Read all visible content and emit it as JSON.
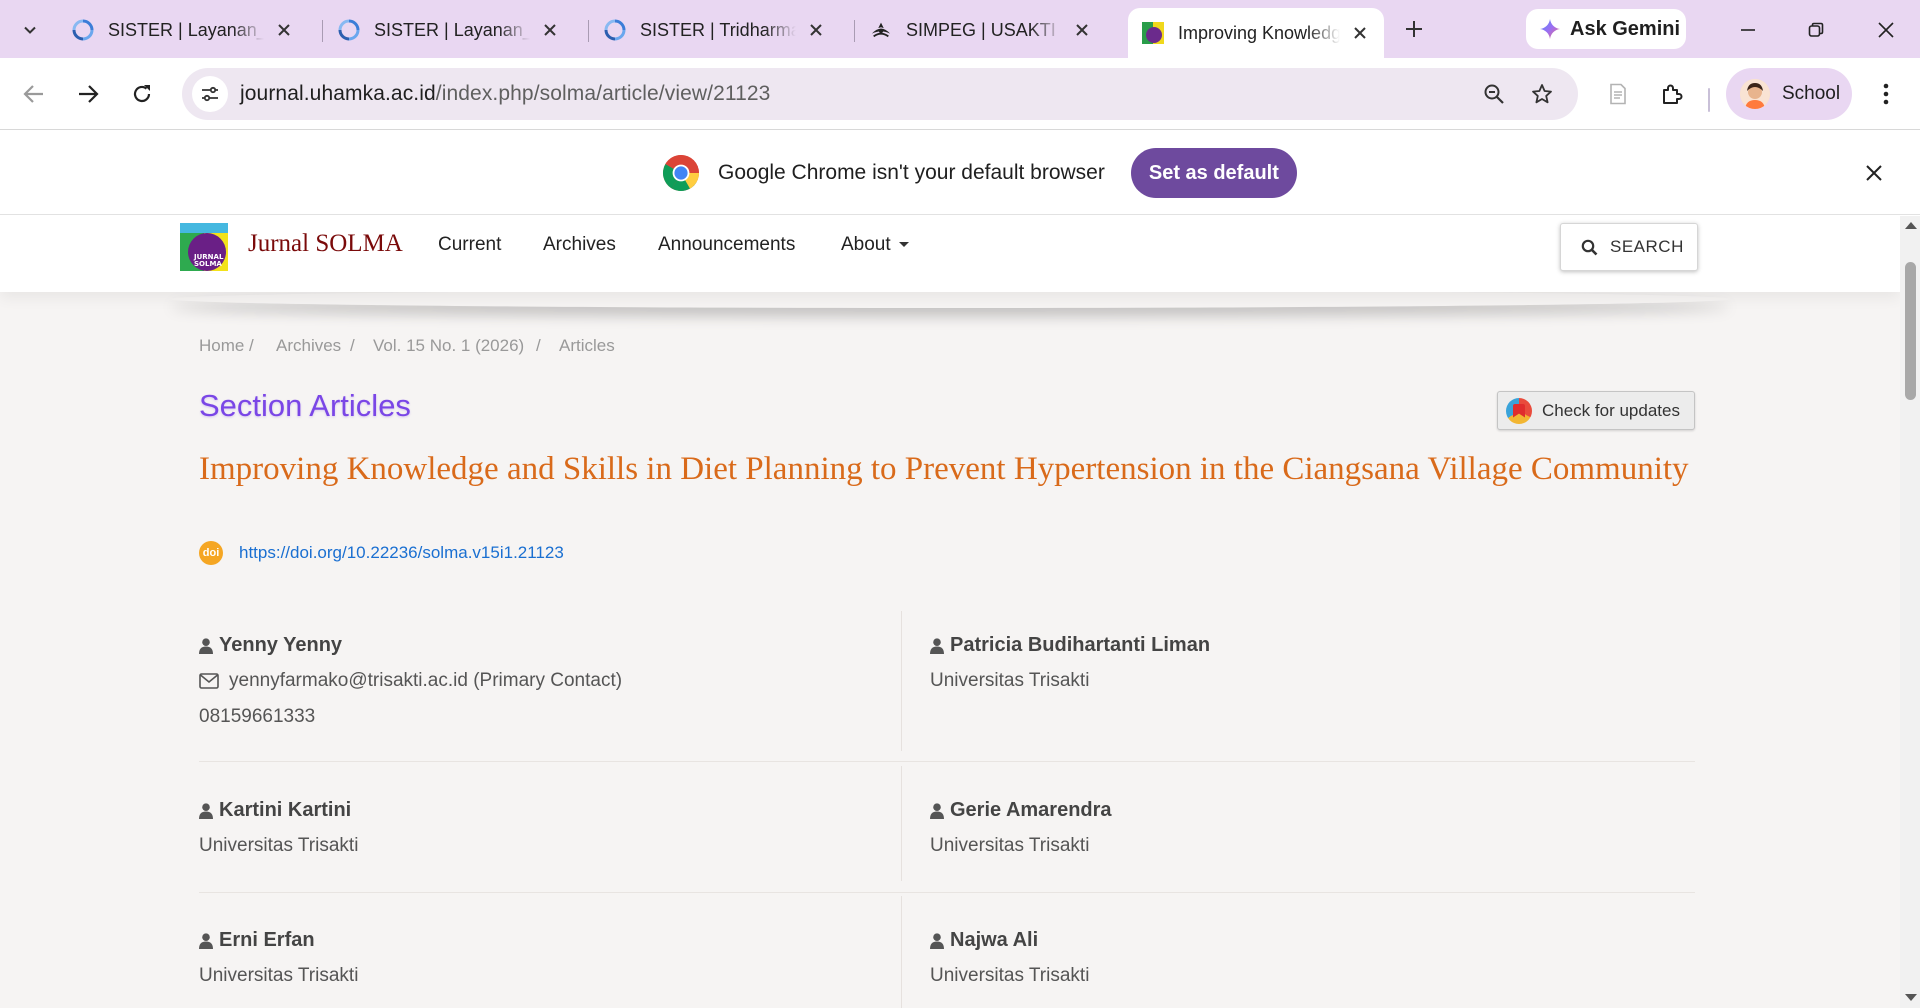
{
  "browser": {
    "tabs": [
      {
        "title": "SISTER | Layanan_bk",
        "icon": "sister-favicon"
      },
      {
        "title": "SISTER | Layanan_bk",
        "icon": "sister-favicon"
      },
      {
        "title": "SISTER | Tridharma",
        "icon": "sister-favicon"
      },
      {
        "title": "SIMPEG | USAKTI",
        "icon": "usakti-favicon"
      },
      {
        "title": "Improving Knowledge and Skills",
        "icon": "solma-favicon",
        "active": true
      }
    ],
    "ask_gemini": "Ask Gemini",
    "url_host": "journal.uhamka.ac.id",
    "url_path": "/index.php/solma/article/view/21123",
    "profile_label": "School"
  },
  "infobar": {
    "message": "Google Chrome isn't your default browser",
    "button": "Set as default"
  },
  "site": {
    "brand": "Jurnal SOLMA",
    "logo_text": "JURNAL SOLMA",
    "nav": [
      "Current",
      "Archives",
      "Announcements",
      "About"
    ],
    "search_label": "SEARCH"
  },
  "breadcrumb": [
    "Home",
    "Archives",
    "Vol. 15 No. 1 (2026)",
    "Articles"
  ],
  "section_title": "Section Articles",
  "check_updates": "Check for updates",
  "article": {
    "title": "Improving Knowledge and Skills in Diet Planning to Prevent Hypertension in the Ciangsana Village Community",
    "doi_badge": "doi",
    "doi": "https://doi.org/10.22236/solma.v15i1.21123"
  },
  "authors": [
    {
      "name": "Yenny Yenny",
      "email": "yennyfarmako@trisakti.ac.id (Primary Contact)",
      "phone": "08159661333"
    },
    {
      "name": "Patricia Budihartanti Liman",
      "affiliation": "Universitas Trisakti"
    },
    {
      "name": "Kartini Kartini",
      "affiliation": "Universitas Trisakti"
    },
    {
      "name": "Gerie Amarendra",
      "affiliation": "Universitas Trisakti"
    },
    {
      "name": "Erni Erfan",
      "affiliation": "Universitas Trisakti"
    },
    {
      "name": "Najwa Ali",
      "affiliation": "Universitas Trisakti"
    }
  ],
  "colors": {
    "tabstrip": "#e9d7f2",
    "set_default_button": "#6e4a9e",
    "section_title": "#7a46e6",
    "article_title": "#d96a1a",
    "link": "#1a6fd1",
    "brand": "#7a0a0a"
  }
}
